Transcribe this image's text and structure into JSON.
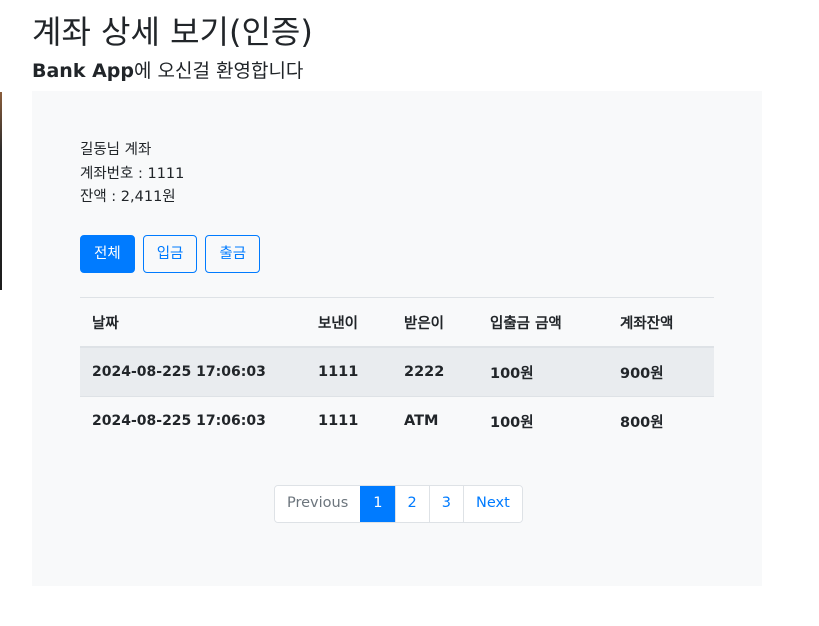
{
  "header": {
    "title": "계좌 상세 보기(인증)",
    "welcome_brand": "Bank App",
    "welcome_text": "에 오신걸 환영합니다"
  },
  "account": {
    "owner_line": "길동님 계좌",
    "number_line": "계좌번호 : 1111",
    "balance_line": "잔액 : 2,411원"
  },
  "filters": [
    {
      "label": "전체",
      "active": true
    },
    {
      "label": "입금",
      "active": false
    },
    {
      "label": "출금",
      "active": false
    }
  ],
  "table": {
    "columns": [
      "날짜",
      "보낸이",
      "받은이",
      "입출금 금액",
      "계좌잔액"
    ],
    "rows": [
      [
        "2024-08-225 17:06:03",
        "1111",
        "2222",
        "100원",
        "900원"
      ],
      [
        "2024-08-225 17:06:03",
        "1111",
        "ATM",
        "100원",
        "800원"
      ]
    ]
  },
  "pagination": {
    "previous": "Previous",
    "pages": [
      "1",
      "2",
      "3"
    ],
    "current": "1",
    "next": "Next"
  },
  "colors": {
    "primary": "#007bff",
    "panel_bg": "#f8f9fa",
    "striped_row": "#e9ecef",
    "border": "#dee2e6"
  }
}
